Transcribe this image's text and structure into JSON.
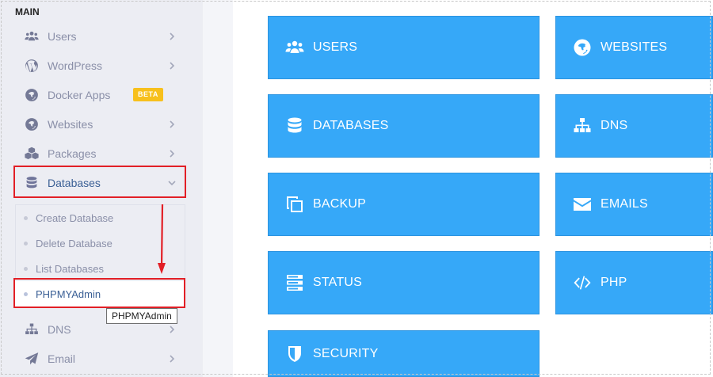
{
  "sidebar": {
    "section_title": "MAIN",
    "items": [
      {
        "label": "Users",
        "icon": "users-icon"
      },
      {
        "label": "WordPress",
        "icon": "wordpress-icon"
      },
      {
        "label": "Docker Apps",
        "icon": "globe-icon",
        "badge": "BETA"
      },
      {
        "label": "Websites",
        "icon": "globe-icon"
      },
      {
        "label": "Packages",
        "icon": "packages-icon"
      },
      {
        "label": "Databases",
        "icon": "database-icon"
      },
      {
        "label": "DNS",
        "icon": "sitemap-icon"
      },
      {
        "label": "Email",
        "icon": "paper-plane-icon"
      }
    ],
    "databases_submenu": [
      {
        "label": "Create Database"
      },
      {
        "label": "Delete Database"
      },
      {
        "label": "List Databases"
      },
      {
        "label": "PHPMYAdmin"
      }
    ],
    "tooltip": "PHPMYAdmin"
  },
  "tiles": [
    {
      "label": "USERS",
      "icon": "users-icon"
    },
    {
      "label": "WEBSITES",
      "icon": "globe-icon"
    },
    {
      "label": "DATABASES",
      "icon": "database-icon"
    },
    {
      "label": "DNS",
      "icon": "sitemap-icon"
    },
    {
      "label": "BACKUP",
      "icon": "copy-icon"
    },
    {
      "label": "EMAILS",
      "icon": "envelope-icon"
    },
    {
      "label": "STATUS",
      "icon": "server-icon"
    },
    {
      "label": "PHP",
      "icon": "code-icon"
    },
    {
      "label": "SECURITY",
      "icon": "shield-icon"
    }
  ],
  "colors": {
    "tile_blue": "#36a8f8",
    "highlight_red": "#e21f26",
    "badge_yellow": "#f7c01c",
    "sidebar_bg": "#ecedf3",
    "active_text": "#3a5f95"
  }
}
